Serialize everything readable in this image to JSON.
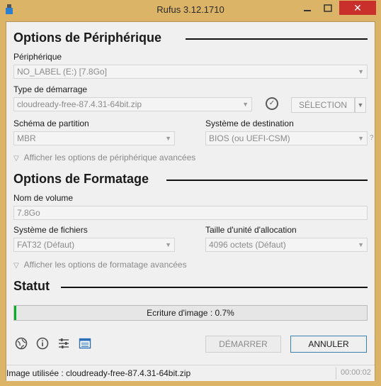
{
  "window": {
    "title": "Rufus 3.12.1710",
    "close_label": "✕",
    "frame_color": "#dcb468"
  },
  "device_section": {
    "title": "Options de Périphérique",
    "device_label": "Périphérique",
    "device_value": "NO_LABEL (E:) [7.8Go]",
    "boot_label": "Type de démarrage",
    "boot_value": "cloudready-free-87.4.31-64bit.zip",
    "select_button": "SÉLECTION",
    "partition_label": "Schéma de partition",
    "partition_value": "MBR",
    "target_label": "Système de destination",
    "target_value": "BIOS (ou UEFI-CSM)",
    "help_mark": "?",
    "advanced": "Afficher les options de périphérique avancées"
  },
  "format_section": {
    "title": "Options de Formatage",
    "volume_label": "Nom de volume",
    "volume_value": "7.8Go",
    "fs_label": "Système de fichiers",
    "fs_value": "FAT32 (Défaut)",
    "cluster_label": "Taille d'unité d'allocation",
    "cluster_value": "4096 octets (Défaut)",
    "advanced": "Afficher les options de formatage avancées"
  },
  "status_section": {
    "title": "Statut",
    "progress_text": "Ecriture d'image : 0.7%",
    "progress_percent": 0.7,
    "progress_color": "#06b025"
  },
  "toolbar": {
    "icons": [
      "globe-icon",
      "info-icon",
      "settings-sliders-icon",
      "log-icon"
    ],
    "start_button": "DÉMARRER",
    "cancel_button": "ANNULER"
  },
  "statusbar": {
    "text": "Image utilisée : cloudready-free-87.4.31-64bit.zip",
    "time": "00:00:02"
  }
}
